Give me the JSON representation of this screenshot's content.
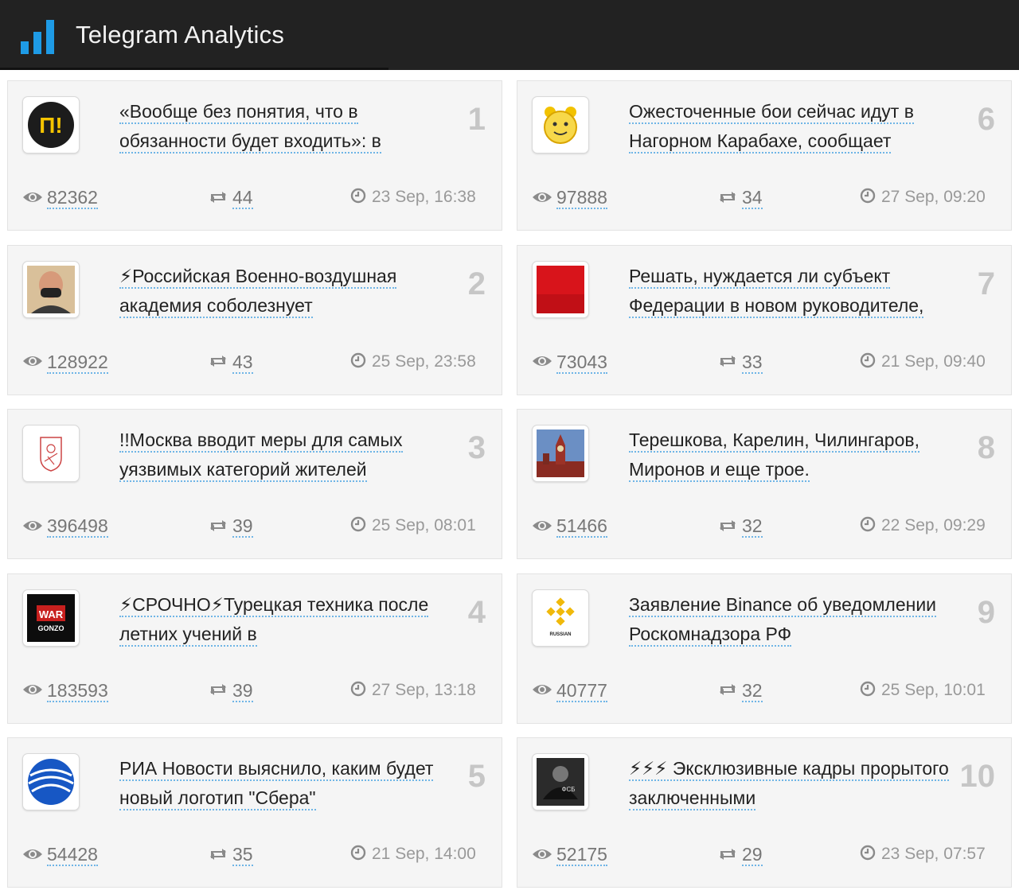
{
  "app": {
    "title": "Telegram Analytics"
  },
  "colors": {
    "header_bg": "#222222",
    "accent": "#1e9be6",
    "card_bg": "#f5f5f5"
  },
  "posts": [
    {
      "rank": "1",
      "title": "«Вообще без понятия, что в обязанности будет входить»: в",
      "views": "82362",
      "reposts": "44",
      "date": "23 Sep, 16:38",
      "avatar": "paper-logo",
      "column": 0,
      "row": 0
    },
    {
      "rank": "2",
      "title": "⚡Российская Военно-воздушная академия соболезнует",
      "views": "128922",
      "reposts": "43",
      "date": "25 Sep, 23:58",
      "avatar": "man-mask-photo",
      "column": 0,
      "row": 1
    },
    {
      "rank": "3",
      "title": "!!Москва вводит меры для самых уязвимых категорий жителей",
      "views": "396498",
      "reposts": "39",
      "date": "25 Sep, 08:01",
      "avatar": "moscow-coat-of-arms",
      "column": 0,
      "row": 2
    },
    {
      "rank": "4",
      "title": "⚡СРОЧНО⚡Турецкая техника после летних учений в",
      "views": "183593",
      "reposts": "39",
      "date": "27 Sep, 13:18",
      "avatar": "war-gonzo-logo",
      "avatar_text": [
        "WAR",
        "GONZO"
      ],
      "column": 0,
      "row": 3
    },
    {
      "rank": "5",
      "title": "РИА Новости выяснило, каким будет новый логотип \"Сбера\"",
      "views": "54428",
      "reposts": "35",
      "date": "21 Sep, 14:00",
      "avatar": "ria-globe-logo",
      "column": 0,
      "row": 4
    },
    {
      "rank": "6",
      "title": "Ожесточенные бои сейчас идут в Нагорном Карабахе, сообщает",
      "views": "97888",
      "reposts": "34",
      "date": "27 Sep, 09:20",
      "avatar": "alarm-clock",
      "column": 1,
      "row": 0
    },
    {
      "rank": "7",
      "title": "Решать, нуждается ли субъект Федерации в новом руководителе,",
      "views": "73043",
      "reposts": "33",
      "date": "21 Sep, 09:40",
      "avatar": "red-square",
      "column": 1,
      "row": 1
    },
    {
      "rank": "8",
      "title": "Терешкова, Карелин, Чилингаров, Миронов и еще трое.",
      "views": "51466",
      "reposts": "32",
      "date": "22 Sep, 09:29",
      "avatar": "kremlin-tower-photo",
      "column": 1,
      "row": 2
    },
    {
      "rank": "9",
      "title": "Заявление Binance об уведомлении Роскомнадзора РФ",
      "views": "40777",
      "reposts": "32",
      "date": "25 Sep, 10:01",
      "avatar": "binance-logo",
      "avatar_text": [
        "RUSSIAN"
      ],
      "column": 1,
      "row": 3
    },
    {
      "rank": "10",
      "title": "⚡⚡⚡ Эксклюзивные кадры прорытого заключенными",
      "views": "52175",
      "reposts": "29",
      "date": "23 Sep, 07:57",
      "avatar": "fsb-photo",
      "avatar_text": [
        "ФСБ"
      ],
      "column": 1,
      "row": 4
    }
  ]
}
